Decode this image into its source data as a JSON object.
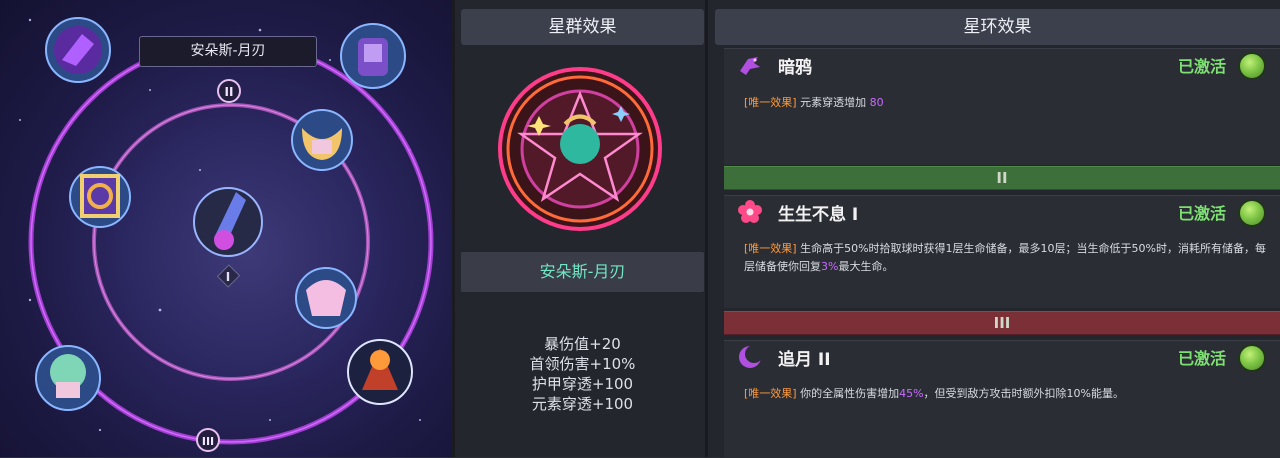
{
  "constellation": {
    "name_tag": "安朵斯-月刃",
    "ring_markers": [
      "II",
      "III"
    ],
    "center_node_marker": "I"
  },
  "cluster_panel": {
    "header": "星群效果",
    "name": "安朵斯-月刃",
    "stats": [
      "暴伤值+20",
      "首领伤害+10%",
      "护甲穿透+100",
      "元素穿透+100"
    ]
  },
  "ring_panel": {
    "header": "星环效果",
    "effects": [
      {
        "title": "暗鸦",
        "status": "已激活",
        "tag": "[唯一效果]",
        "text_before": "元素穿透增加",
        "highlight": "80",
        "text_after": ""
      },
      {
        "title": "生生不息 I",
        "status": "已激活",
        "tag": "[唯一效果]",
        "text_before": "生命高于50%时拾取球时获得1层生命储备，最多10层；当生命低于50%时，消耗所有储备，每层储备使你回复",
        "highlight": "3%",
        "text_after": "最大生命。"
      },
      {
        "title": "追月 II",
        "status": "已激活",
        "tag": "[唯一效果]",
        "text_before": "你的全属性伤害增加",
        "highlight": "45%",
        "text_after": "，但受到敌方攻击时额外扣除10%能量。"
      }
    ],
    "tier_dividers": [
      "II",
      "III"
    ]
  },
  "colors": {
    "active_status": "#7de072",
    "tag_orange": "#ff9a3a",
    "highlight_purple": "#c76bff",
    "cluster_name": "#73e6c6",
    "tier2_divider": "#3c6f3a",
    "tier3_divider": "#7a3036"
  }
}
